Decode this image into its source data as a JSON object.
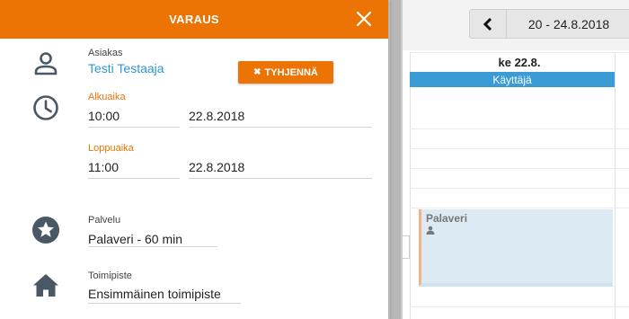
{
  "dialog": {
    "title": "VARAUS",
    "close_icon": "close-icon",
    "customer": {
      "label": "Asiakas",
      "name": "Testi Testaaja",
      "icon": "person-icon"
    },
    "clear_button": {
      "glyph": "✖",
      "label": "TYHJENNÄ"
    },
    "start": {
      "label": "Alkuaika",
      "time": "10:00",
      "date": "22.8.2018",
      "icon": "clock-icon"
    },
    "end": {
      "label": "Loppuaika",
      "time": "11:00",
      "date": "22.8.2018"
    },
    "service": {
      "label": "Palvelu",
      "value": "Palaveri - 60 min",
      "icon": "star-icon"
    },
    "location": {
      "label": "Toimipiste",
      "value": "Ensimmäinen toimipiste",
      "icon": "home-icon"
    }
  },
  "calendar": {
    "prev_icon": "chevron-left-icon",
    "date_range": "20 - 24.8.2018",
    "day_header": "ke 22.8.",
    "resource": "Käyttäjä",
    "event": {
      "title": "Palaveri",
      "icon": "person-small-icon"
    }
  },
  "colors": {
    "accent": "#ec7405",
    "link": "#2e95d3",
    "resource_bar": "#3a9bd5",
    "event_bg": "#dcebf3",
    "icon": "#4a5865"
  }
}
